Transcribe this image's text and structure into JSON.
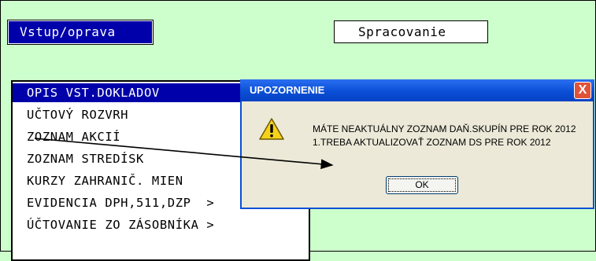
{
  "top_buttons": {
    "vstup": "Vstup/oprava",
    "spracovanie": "Spracovanie"
  },
  "menu": {
    "items": [
      "OPIS VST.DOKLADOV",
      "UČTOVÝ ROZVRH",
      "ZOZNAM AKCIÍ",
      "ZOZNAM STREDÍSK",
      "KURZY ZAHRANIČ. MIEN",
      "EVIDENCIA DPH,511,DZP  >",
      "ÚČTOVANIE ZO ZÁSOBNÍKA >"
    ],
    "selected_index": 0
  },
  "dialog": {
    "title": "UPOZORNENIE",
    "close_label": "X",
    "message_line1": "MÁTE NEAKTUÁLNY ZOZNAM DAŇ.SKUPÍN PRE ROK 2012",
    "message_line2": "1.TREBA AKTUALIZOVAŤ ZOZNAM DS PRE ROK 2012",
    "ok_label": "OK",
    "icon": "warning-icon"
  },
  "colors": {
    "background": "#ccffcc",
    "menu_selection": "#0000aa",
    "dialog_title": "#0a4fd6"
  }
}
